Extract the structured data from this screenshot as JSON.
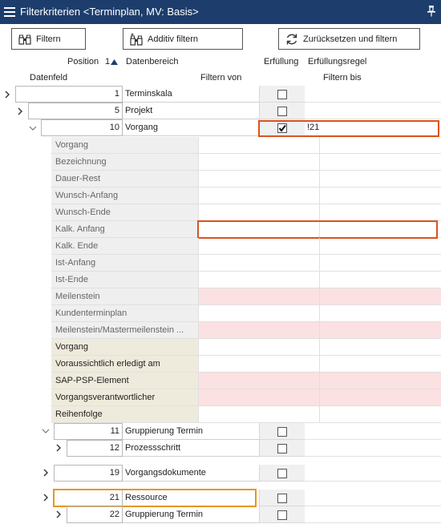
{
  "window": {
    "title": "Filterkriterien <Terminplan, MV: Basis>"
  },
  "toolbar": {
    "filter_label": "Filtern",
    "additive_label": "Additiv filtern",
    "reset_label": "Zurücksetzen und filtern"
  },
  "columns": {
    "position": "Position",
    "sort_index": "1",
    "datenbereich": "Datenbereich",
    "erfuellung": "Erfüllung",
    "erfuellungsregel": "Erfüllungsregel",
    "datenfeld": "Datenfeld",
    "filtern_von": "Filtern von",
    "filtern_bis": "Filtern bis"
  },
  "rows": [
    {
      "pos": "1",
      "name": "Terminskala",
      "checked": false,
      "rule": ""
    },
    {
      "pos": "5",
      "name": "Projekt",
      "checked": false,
      "rule": ""
    },
    {
      "pos": "10",
      "name": "Vorgang",
      "checked": true,
      "rule": "!21"
    },
    {
      "pos": "11",
      "name": "Gruppierung Termin",
      "checked": false,
      "rule": ""
    },
    {
      "pos": "12",
      "name": "Prozessschritt",
      "checked": false,
      "rule": ""
    },
    {
      "pos": "19",
      "name": "Vorgangsdokumente",
      "checked": false,
      "rule": ""
    },
    {
      "pos": "21",
      "name": "Ressource",
      "checked": false,
      "rule": ""
    },
    {
      "pos": "22",
      "name": "Gruppierung Termin",
      "checked": false,
      "rule": ""
    }
  ],
  "fields": [
    {
      "name": "Vorgang",
      "group": "gray",
      "pink": false
    },
    {
      "name": "Bezeichnung",
      "group": "gray",
      "pink": false
    },
    {
      "name": "Dauer-Rest",
      "group": "gray",
      "pink": false
    },
    {
      "name": "Wunsch-Anfang",
      "group": "gray",
      "pink": false
    },
    {
      "name": "Wunsch-Ende",
      "group": "gray",
      "pink": false
    },
    {
      "name": "Kalk. Anfang",
      "group": "gray",
      "pink": false
    },
    {
      "name": "Kalk. Ende",
      "group": "gray",
      "pink": false
    },
    {
      "name": "Ist-Anfang",
      "group": "gray",
      "pink": false
    },
    {
      "name": "Ist-Ende",
      "group": "gray",
      "pink": false
    },
    {
      "name": "Meilenstein",
      "group": "gray",
      "pink": true
    },
    {
      "name": "Kundenterminplan",
      "group": "gray",
      "pink": false
    },
    {
      "name": "Meilenstein/Mastermeilenstein ...",
      "group": "gray",
      "pink": true
    },
    {
      "name": "Vorgang",
      "group": "tan",
      "pink": false
    },
    {
      "name": "Voraussichtlich erledigt am",
      "group": "tan",
      "pink": false
    },
    {
      "name": "SAP-PSP-Element",
      "group": "tan",
      "pink": true
    },
    {
      "name": "Vorgangsverantwortlicher",
      "group": "tan",
      "pink": true
    },
    {
      "name": "Reihenfolge",
      "group": "tan",
      "pink": false
    }
  ],
  "colors": {
    "titlebar": "#1d3e6c",
    "selection_red": "#d9531e",
    "selection_orange": "#e8961c",
    "pink_field": "#fbe1e2",
    "tan_group": "#efebdc",
    "gray_group": "#efefef"
  },
  "icons": {
    "menu": "hamburger-icon",
    "pin": "pin-icon",
    "filter": "binoculars-icon",
    "additive": "binoculars-plus-icon",
    "reset": "refresh-icon",
    "sort": "sort-ascending-icon"
  }
}
